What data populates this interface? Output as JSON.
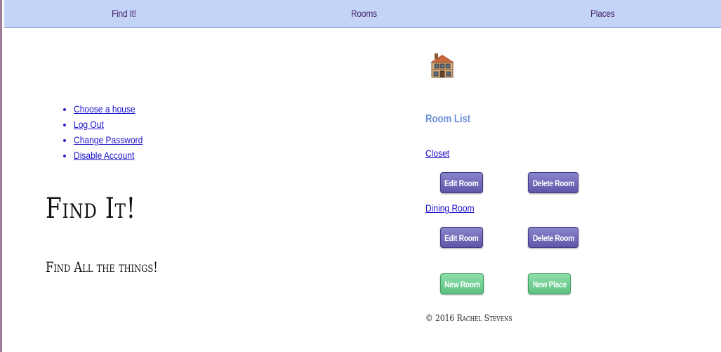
{
  "nav": {
    "items": [
      {
        "label": "Find It!"
      },
      {
        "label": "Rooms"
      },
      {
        "label": "Places"
      }
    ]
  },
  "account_menu": {
    "items": [
      {
        "label": "Choose a house"
      },
      {
        "label": "Log Out"
      },
      {
        "label": "Change Password"
      },
      {
        "label": "Disable Account"
      }
    ]
  },
  "hero": {
    "title": "Find It!",
    "subtitle": "Find All the things!"
  },
  "house_icon": "house-building-icon",
  "room_list": {
    "heading": "Room List",
    "rooms": [
      {
        "name": "Closet",
        "edit_label": "Edit Room",
        "delete_label": "Delete Room"
      },
      {
        "name": "Dining Room",
        "edit_label": "Edit Room",
        "delete_label": "Delete Room"
      }
    ],
    "new_room_label": "New Room",
    "new_place_label": "New Place"
  },
  "footer": {
    "copyright": "© 2016 Rachel Stevens"
  },
  "colors": {
    "nav_background": "#c3d4f7",
    "nav_text": "#4a2a6e",
    "link": "#1a12c8",
    "heading_accent": "#6b8fd9",
    "button_purple": "#6f68b8",
    "button_green": "#6fcf90"
  }
}
